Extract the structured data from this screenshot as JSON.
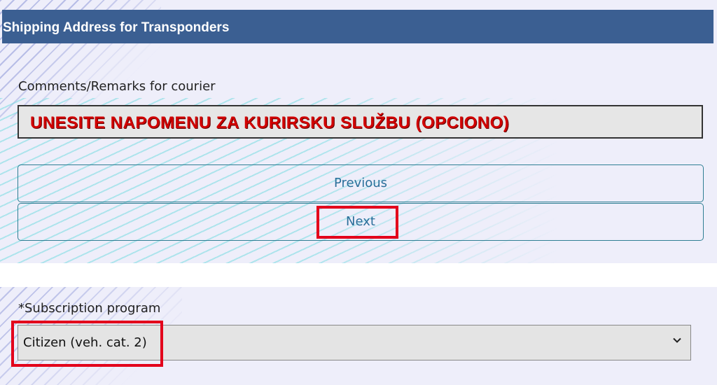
{
  "header": {
    "title": "Shipping Address for Transponders"
  },
  "comments": {
    "label": "Comments/Remarks for courier",
    "value": "UNESITE NAPOMENU ZA KURIRSKU SLUŽBU (OPCIONO)"
  },
  "buttons": {
    "previous": "Previous",
    "next": "Next"
  },
  "subscription": {
    "label": "*Subscription program",
    "selected": "Citizen (veh. cat. 2)"
  },
  "icons": {
    "select_arrow": "chevron-down-icon"
  },
  "colors": {
    "header_bg": "#3b5f92",
    "highlight": "#e3001b",
    "annotation_text": "#d10000"
  }
}
